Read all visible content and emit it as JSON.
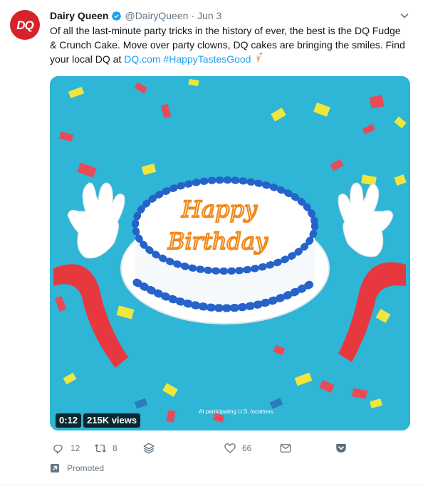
{
  "tweet": {
    "author_name": "Dairy Queen",
    "handle": "@DairyQueen",
    "separator": "·",
    "date": "Jun 3",
    "avatar_text": "DQ",
    "text_part1": "Of all the last-minute party tricks in the history of ever, the best is the DQ Fudge & Crunch Cake. Move over party clowns, DQ cakes are bringing the smiles. Find your local DQ at ",
    "link_text": "DQ.com",
    "hashtag": "#HappyTastesGood"
  },
  "media": {
    "cake_text_line1": "Happy",
    "cake_text_line2": "Birthday",
    "disclaimer": "At participating U.S. locations.",
    "duration": "0:12",
    "views": "215K views"
  },
  "actions": {
    "reply_count": "12",
    "retweet_count": "8",
    "like_count": "66"
  },
  "promoted_label": "Promoted",
  "colors": {
    "link": "#1da1f2",
    "brand_red": "#d6232a",
    "media_bg": "#2fb5d6"
  }
}
